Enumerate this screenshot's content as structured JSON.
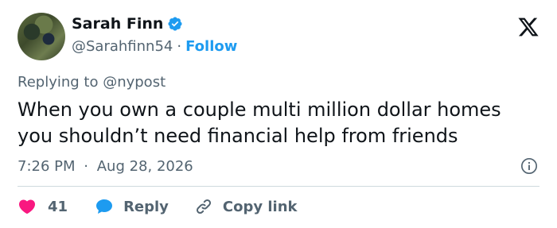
{
  "author": {
    "name": "Sarah Finn",
    "handle": "@Sarahfinn54",
    "separator": "·",
    "follow_label": "Follow"
  },
  "reply_context": "Replying to @nypost",
  "tweet": {
    "text_line1": "When you own a couple multi million dollar homes",
    "text_line2": "you shouldn’t need financial help from friends",
    "time": "7:26 PM",
    "date_separator": "·",
    "date": "Aug 28, 2026"
  },
  "actions": {
    "like_count": "41",
    "reply_label": "Reply",
    "copy_label": "Copy link"
  },
  "icons": {
    "brand": "x-logo-icon",
    "verified": "verified-badge-icon",
    "info": "info-icon",
    "like": "heart-icon",
    "reply": "speech-bubble-icon",
    "copy": "link-icon"
  },
  "colors": {
    "accent": "#1d9bf0",
    "like": "#f91880",
    "muted": "#536471",
    "text": "#0f1419",
    "divider": "#cfd9de"
  }
}
